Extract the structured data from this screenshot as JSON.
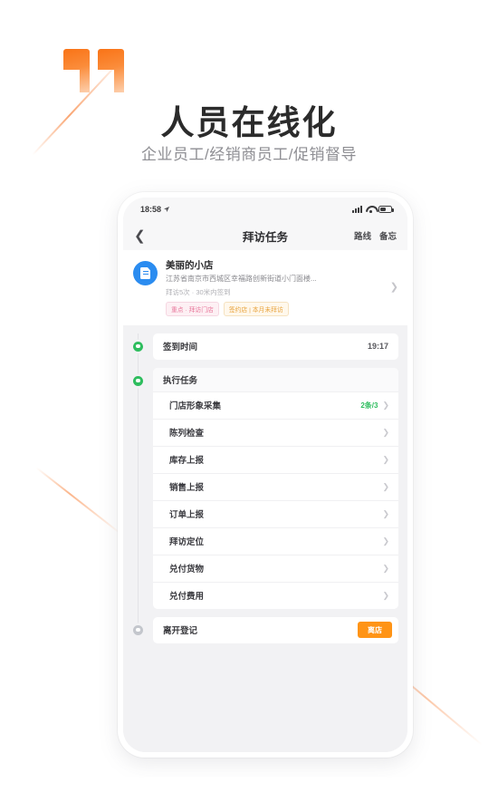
{
  "header": {
    "quote_icon": "quote-mark-icon",
    "title": "人员在线化",
    "subtitle": "企业员工/经销商员工/促销督导"
  },
  "phone": {
    "statusbar": {
      "time": "18:58",
      "location_icon": "location-arrow-icon",
      "signal_icon": "signal-bars-icon",
      "wifi_icon": "wifi-icon",
      "battery_icon": "battery-icon"
    },
    "navbar": {
      "back_icon": "chevron-left-icon",
      "title": "拜访任务",
      "action_1": "路线",
      "action_2": "备忘"
    },
    "store_card": {
      "avatar_icon": "store-document-icon",
      "name": "美丽的小店",
      "address": "江苏省南京市西城区幸福路创新街道小门面楼...",
      "meta": "拜访5次 · 30米内签到",
      "tag_1": "重点 · 拜访门店",
      "tag_2": "签约店 | 本月未拜访",
      "arrow_icon": "chevron-right-icon"
    },
    "timeline": [
      {
        "type": "row",
        "dot": "green",
        "label": "签到时间",
        "value": "19:17"
      },
      {
        "type": "section",
        "dot": "green",
        "label": "执行任务",
        "items": [
          {
            "label": "门店形象采集",
            "count": "2条/3",
            "chevron": "chevron-right-icon"
          },
          {
            "label": "陈列检查",
            "count": "",
            "chevron": "chevron-right-icon"
          },
          {
            "label": "库存上报",
            "count": "",
            "chevron": "chevron-right-icon"
          },
          {
            "label": "销售上报",
            "count": "",
            "chevron": "chevron-right-icon"
          },
          {
            "label": "订单上报",
            "count": "",
            "chevron": "chevron-right-icon"
          },
          {
            "label": "拜访定位",
            "count": "",
            "chevron": "chevron-right-icon"
          },
          {
            "label": "兑付货物",
            "count": "",
            "chevron": "chevron-right-icon"
          },
          {
            "label": "兑付费用",
            "count": "",
            "chevron": "chevron-right-icon"
          }
        ]
      },
      {
        "type": "button-row",
        "dot": "grey",
        "label": "离开登记",
        "button": "离店"
      }
    ]
  },
  "colors": {
    "accent_orange": "#f97316",
    "button_orange": "#ff9416",
    "dot_green": "#2ebd5e",
    "dot_grey": "#c3c6cc",
    "avatar_blue": "#2b8cf0",
    "title_dark": "#2b2b2b",
    "subtitle_grey": "#8e8e93",
    "screen_bg": "#f2f2f4"
  }
}
